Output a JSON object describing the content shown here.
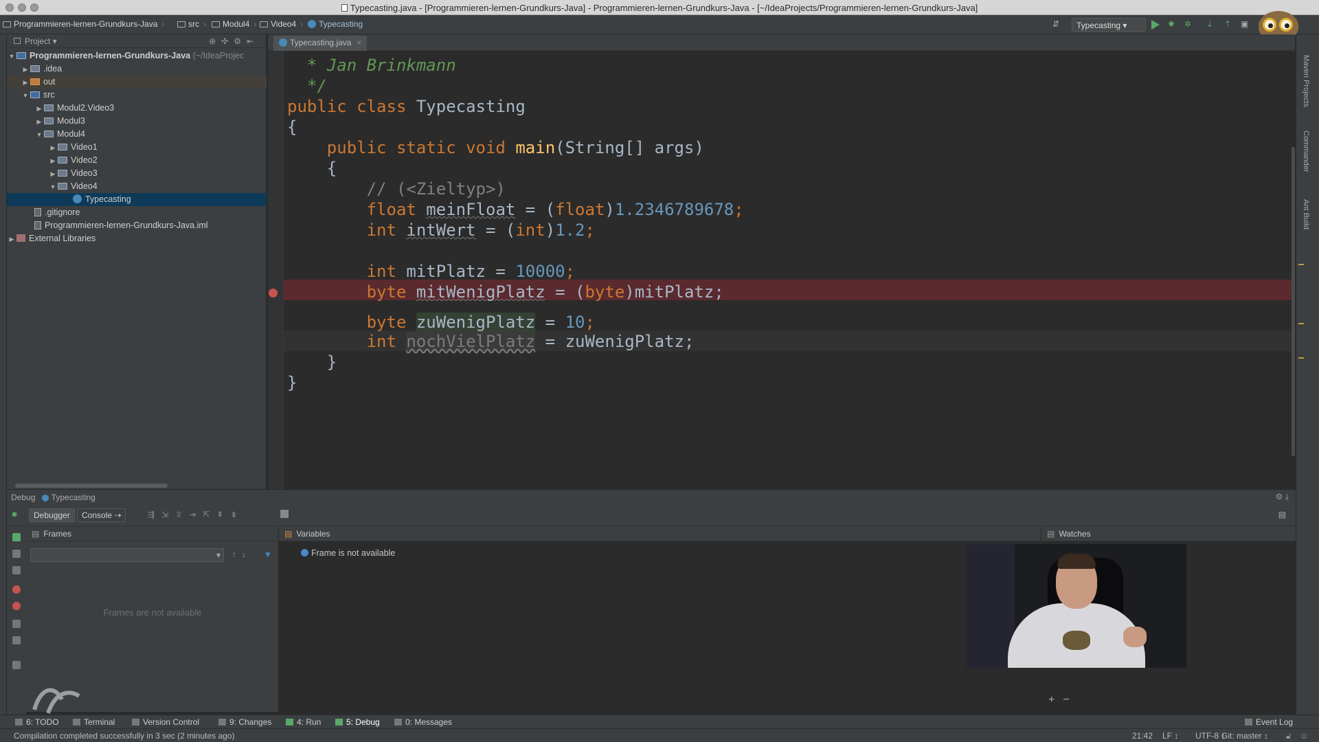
{
  "window": {
    "title": "Typecasting.java - [Programmieren-lernen-Grundkurs-Java] - Programmieren-lernen-Grundkurs-Java - [~/IdeaProjects/Programmieren-lernen-Grundkurs-Java]"
  },
  "navbar": {
    "crumbs": [
      "Programmieren-lernen-Grundkurs-Java",
      "src",
      "Modul4",
      "Video4",
      "Typecasting"
    ],
    "run_config": "Typecasting"
  },
  "project": {
    "header": "Project",
    "tree": [
      {
        "label": "Programmieren-lernen-Grundkurs-Java",
        "suffix": "(~/IdeaProjec"
      },
      {
        "label": ".idea"
      },
      {
        "label": "out"
      },
      {
        "label": "src"
      },
      {
        "label": "Modul2.Video3"
      },
      {
        "label": "Modul3"
      },
      {
        "label": "Modul4"
      },
      {
        "label": "Video1"
      },
      {
        "label": "Video2"
      },
      {
        "label": "Video3"
      },
      {
        "label": "Video4"
      },
      {
        "label": "Typecasting"
      },
      {
        "label": ".gitignore"
      },
      {
        "label": "Programmieren-lernen-Grundkurs-Java.iml"
      },
      {
        "label": "External Libraries"
      }
    ]
  },
  "editor": {
    "tab_label": "Typecasting.java",
    "code": {
      "l1": "* Jan Brinkmann",
      "l2": "*/",
      "l3_kw": "public class ",
      "l3_name": "Typecasting",
      "l4": "{",
      "l5_kw": "public static void ",
      "l5_fn": "main",
      "l5_rest": "(String[] args)",
      "l6": "{",
      "l7": "// (<Zieltyp>)",
      "l8_type": "float ",
      "l8_var": "meinFloat",
      "l8_mid": " = (",
      "l8_cast": "float",
      "l8_close": ")",
      "l8_num": "1.2346789678",
      "l8_end": ";",
      "l9_type": "int ",
      "l9_var": "intWert",
      "l9_mid": " = (",
      "l9_cast": "int",
      "l9_close": ")",
      "l9_num": "1.2",
      "l9_end": ";",
      "l10_type": "int ",
      "l10_var": "mitPlatz",
      "l10_mid": " = ",
      "l10_num": "10000",
      "l10_end": ";",
      "l11_type": "byte ",
      "l11_var": "mitWenigPlatz",
      "l11_mid": " = (",
      "l11_cast": "byte",
      "l11_rest": ")mitPlatz;",
      "l12_type": "byte ",
      "l12_var": "zuWenigPlatz",
      "l12_mid": " = ",
      "l12_num": "10",
      "l12_end": ";",
      "l13_type": "int ",
      "l13_var": "nochVielPlatz",
      "l13_rest": " = zuWenigPlatz;",
      "l14": "}",
      "l15": "}"
    }
  },
  "debug": {
    "header_label": "Debug",
    "config": "Typecasting",
    "tabs": {
      "debugger": "Debugger",
      "console": "Console"
    },
    "frames": {
      "title": "Frames",
      "empty": "Frames are not available"
    },
    "variables": {
      "title": "Variables",
      "info": "Frame is not available"
    },
    "watches": {
      "title": "Watches"
    }
  },
  "toolwindows": [
    {
      "label": "6: TODO"
    },
    {
      "label": "Terminal"
    },
    {
      "label": "Version Control"
    },
    {
      "label": "9: Changes"
    },
    {
      "label": "4: Run"
    },
    {
      "label": "5: Debug"
    },
    {
      "label": "0: Messages"
    },
    {
      "label": "Event Log"
    }
  ],
  "right_strip": {
    "maven": "Maven Projects",
    "commander": "Commander",
    "ant": "Ant Build"
  },
  "status": {
    "message": "Compilation completed successfully in 3 sec (2 minutes ago)",
    "position": "21:42",
    "line_sep": "LF ↕",
    "encoding": "UTF-8 ↕",
    "git": "Git: master ↕"
  },
  "colors": {
    "editor_bg": "#2b2b2b",
    "keyword": "#cc7832",
    "number": "#6897bb",
    "method": "#ffc66d",
    "breakpoint_line": "#5a2a2f",
    "selection": "#0d3a58"
  }
}
